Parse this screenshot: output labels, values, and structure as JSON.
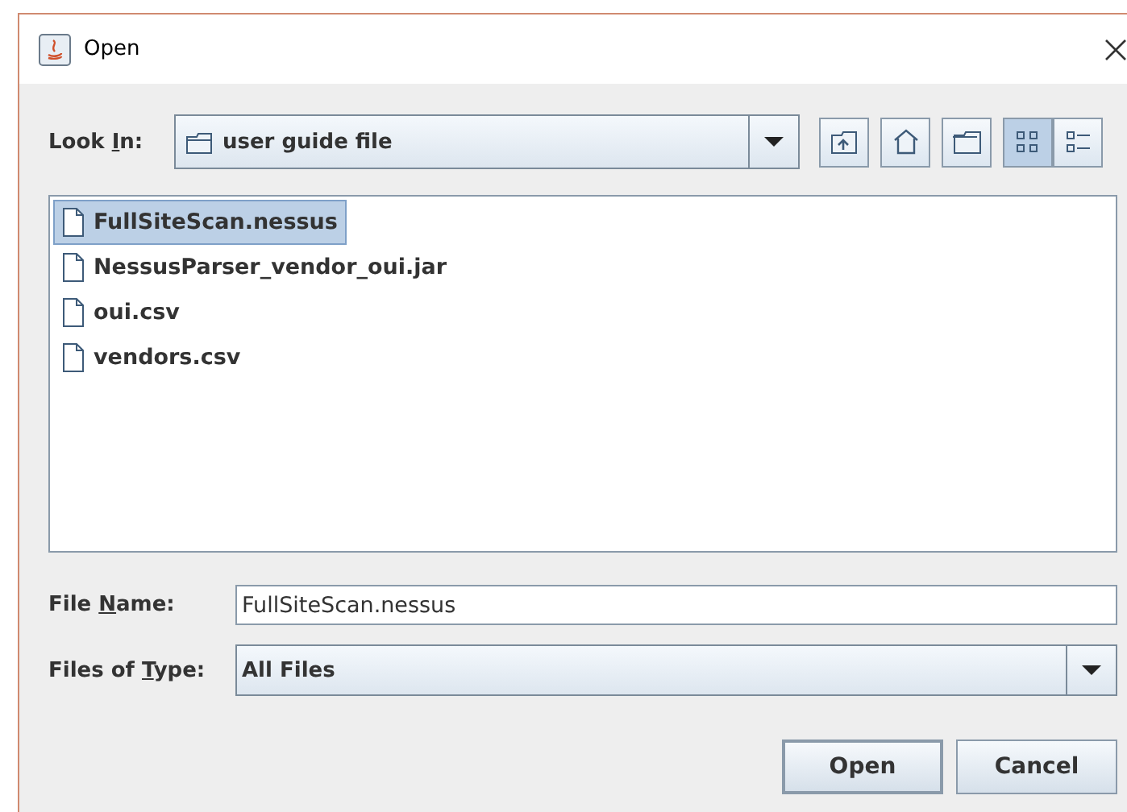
{
  "window": {
    "title": "Open"
  },
  "look_in": {
    "label": {
      "before": "Look ",
      "key": "I",
      "after": "n:"
    },
    "value": "user guide file"
  },
  "view_buttons": [
    {
      "selected": true
    },
    {
      "selected": false
    }
  ],
  "files": [
    {
      "name": "FullSiteScan.nessus",
      "selected": true
    },
    {
      "name": "NessusParser_vendor_oui.jar",
      "selected": false
    },
    {
      "name": "oui.csv",
      "selected": false
    },
    {
      "name": "vendors.csv",
      "selected": false
    }
  ],
  "file_name": {
    "label": {
      "before": "File ",
      "key": "N",
      "after": "ame:"
    },
    "value": "FullSiteScan.nessus"
  },
  "file_type": {
    "label": {
      "before": "Files of ",
      "key": "T",
      "after": "ype:"
    },
    "value": "All Files"
  },
  "buttons": [
    {
      "label": "Open"
    },
    {
      "label": "Cancel"
    }
  ]
}
